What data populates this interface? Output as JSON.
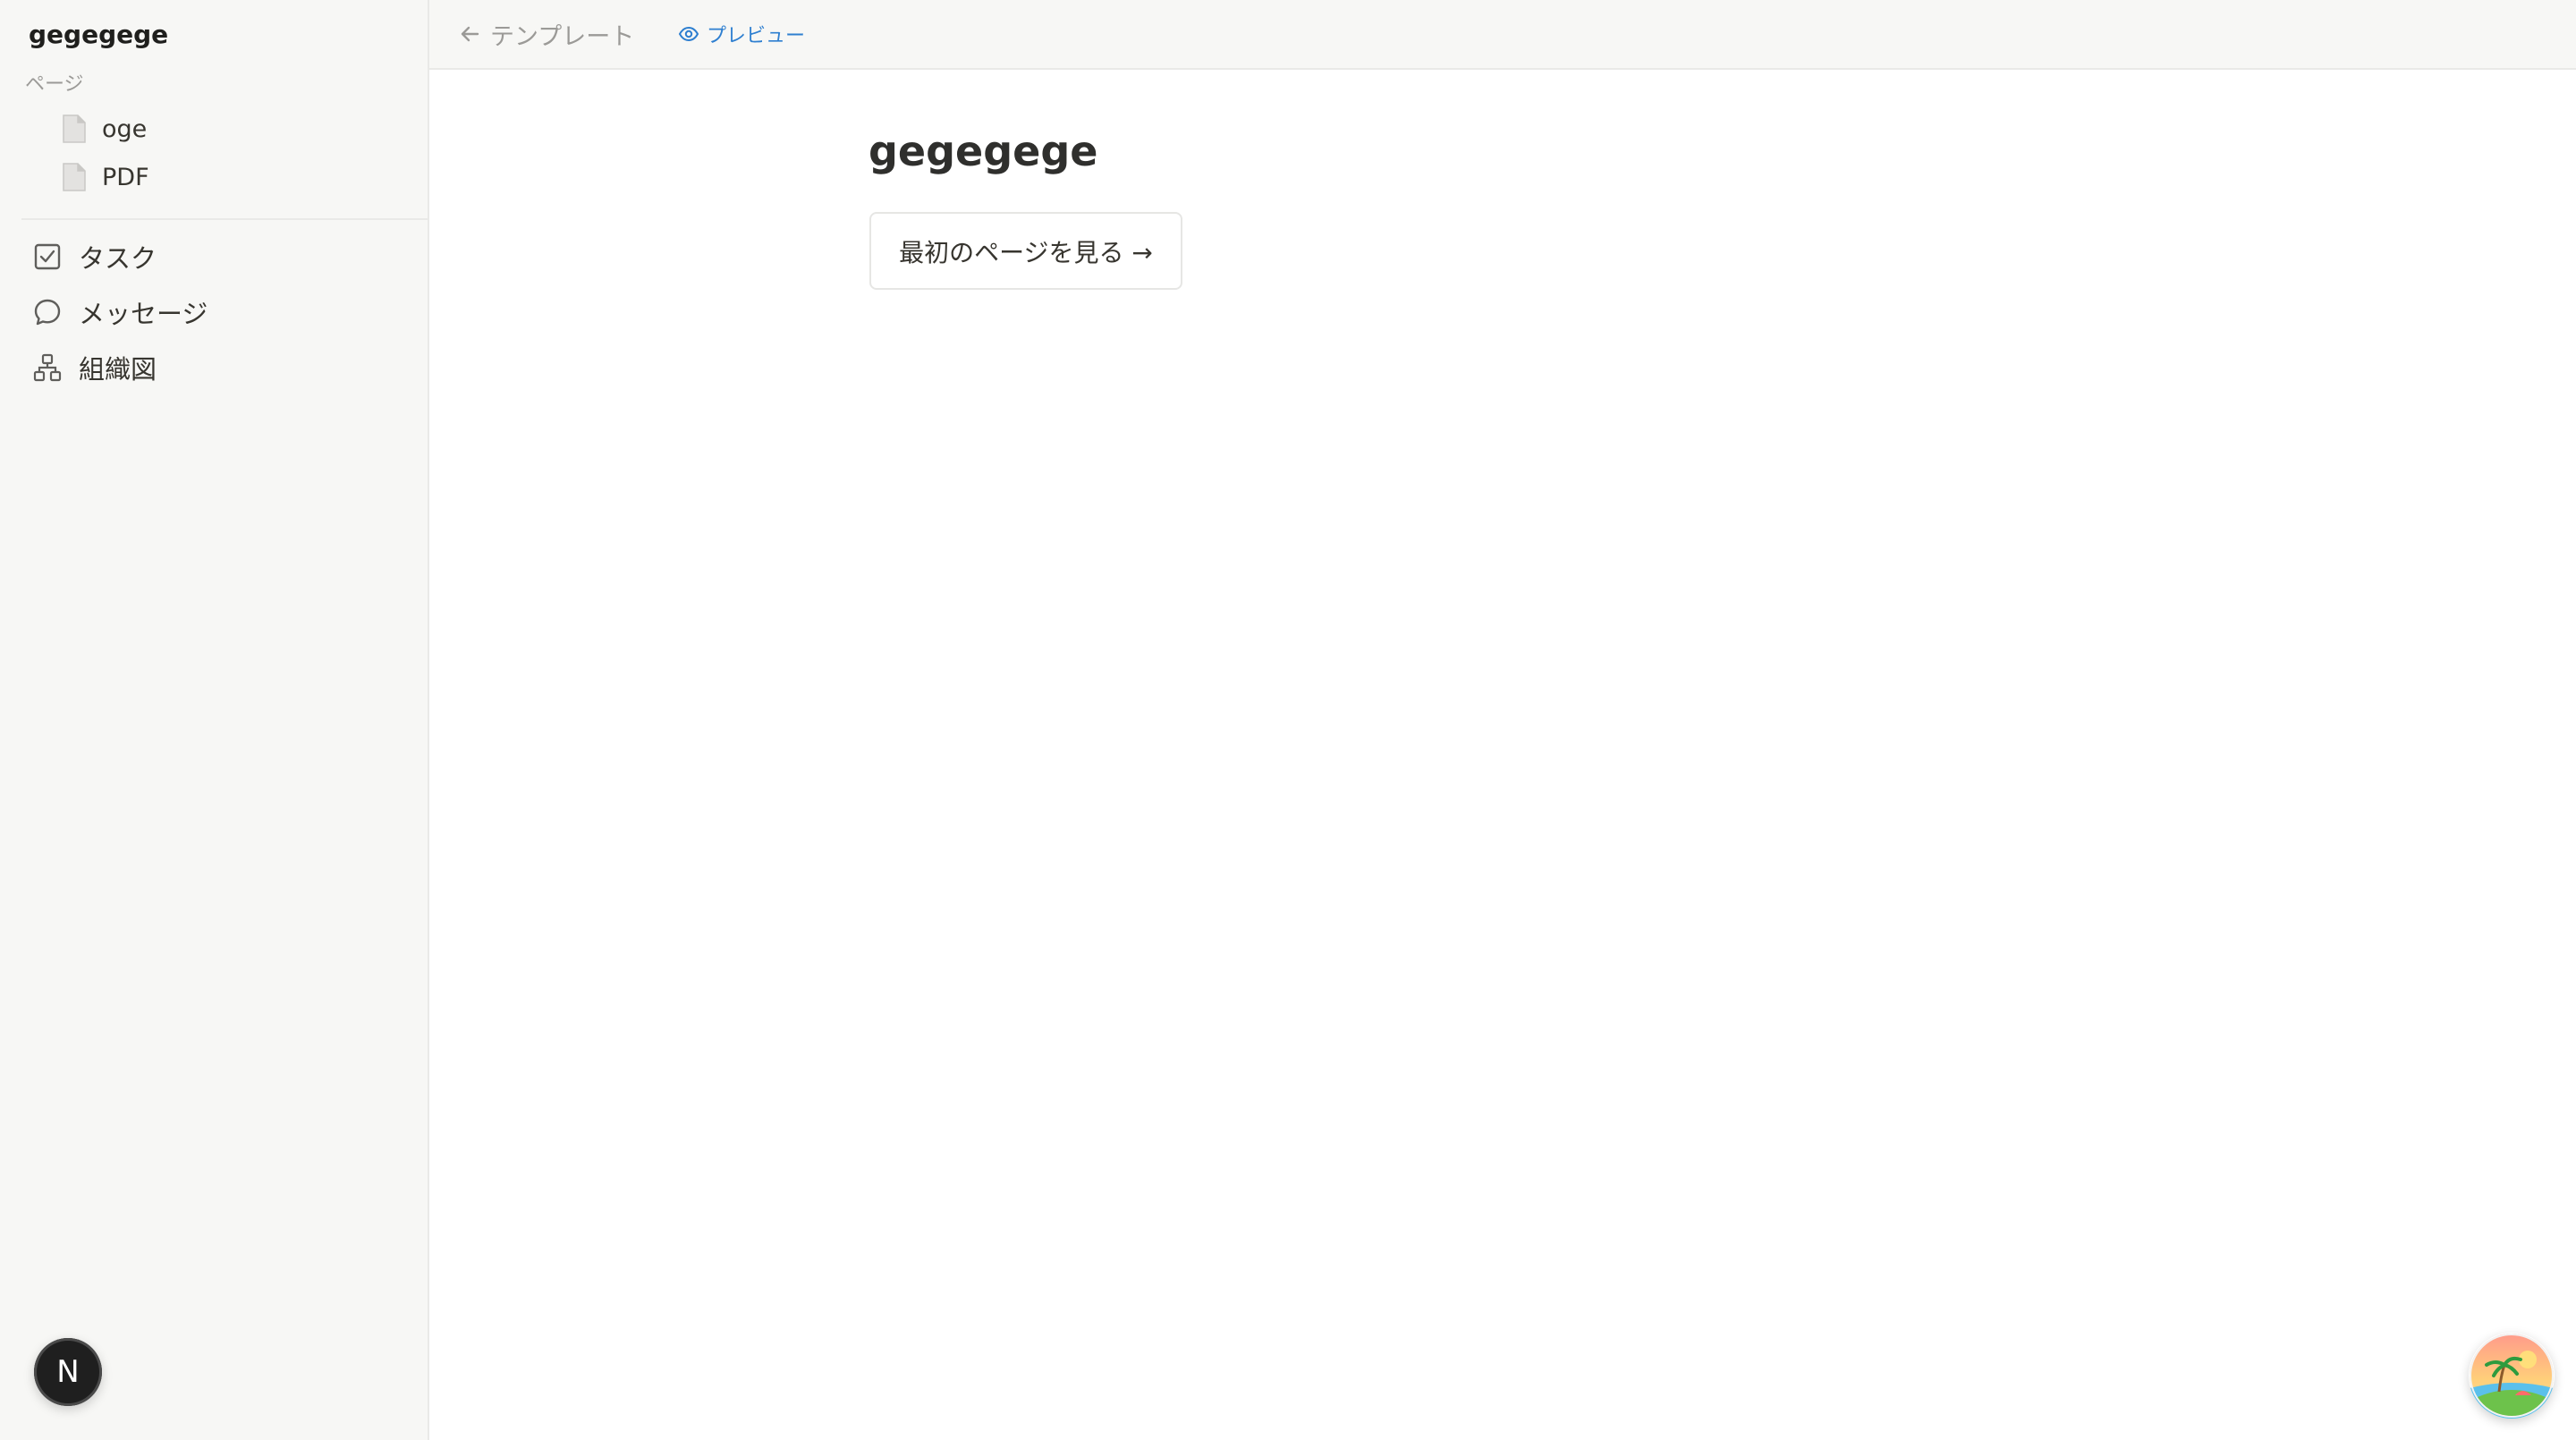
{
  "sidebar": {
    "workspace_title": "gegegege",
    "section_label": "ページ",
    "pages": [
      {
        "label": "oge",
        "icon": "document-icon"
      },
      {
        "label": "PDF",
        "icon": "document-icon"
      }
    ],
    "nav": [
      {
        "label": "タスク",
        "icon": "checkbox-icon"
      },
      {
        "label": "メッセージ",
        "icon": "chat-bubble-icon"
      },
      {
        "label": "組織図",
        "icon": "org-chart-icon"
      }
    ],
    "avatar_initial": "N"
  },
  "topbar": {
    "back_label": "テンプレート",
    "preview_label": "プレビュー"
  },
  "main": {
    "title": "gegegege",
    "first_page_button": "最初のページを見る →"
  },
  "colors": {
    "sidebar_bg": "#f7f7f5",
    "preview_link": "#2e7fd0",
    "avatar_bg": "#1f1f1f"
  }
}
